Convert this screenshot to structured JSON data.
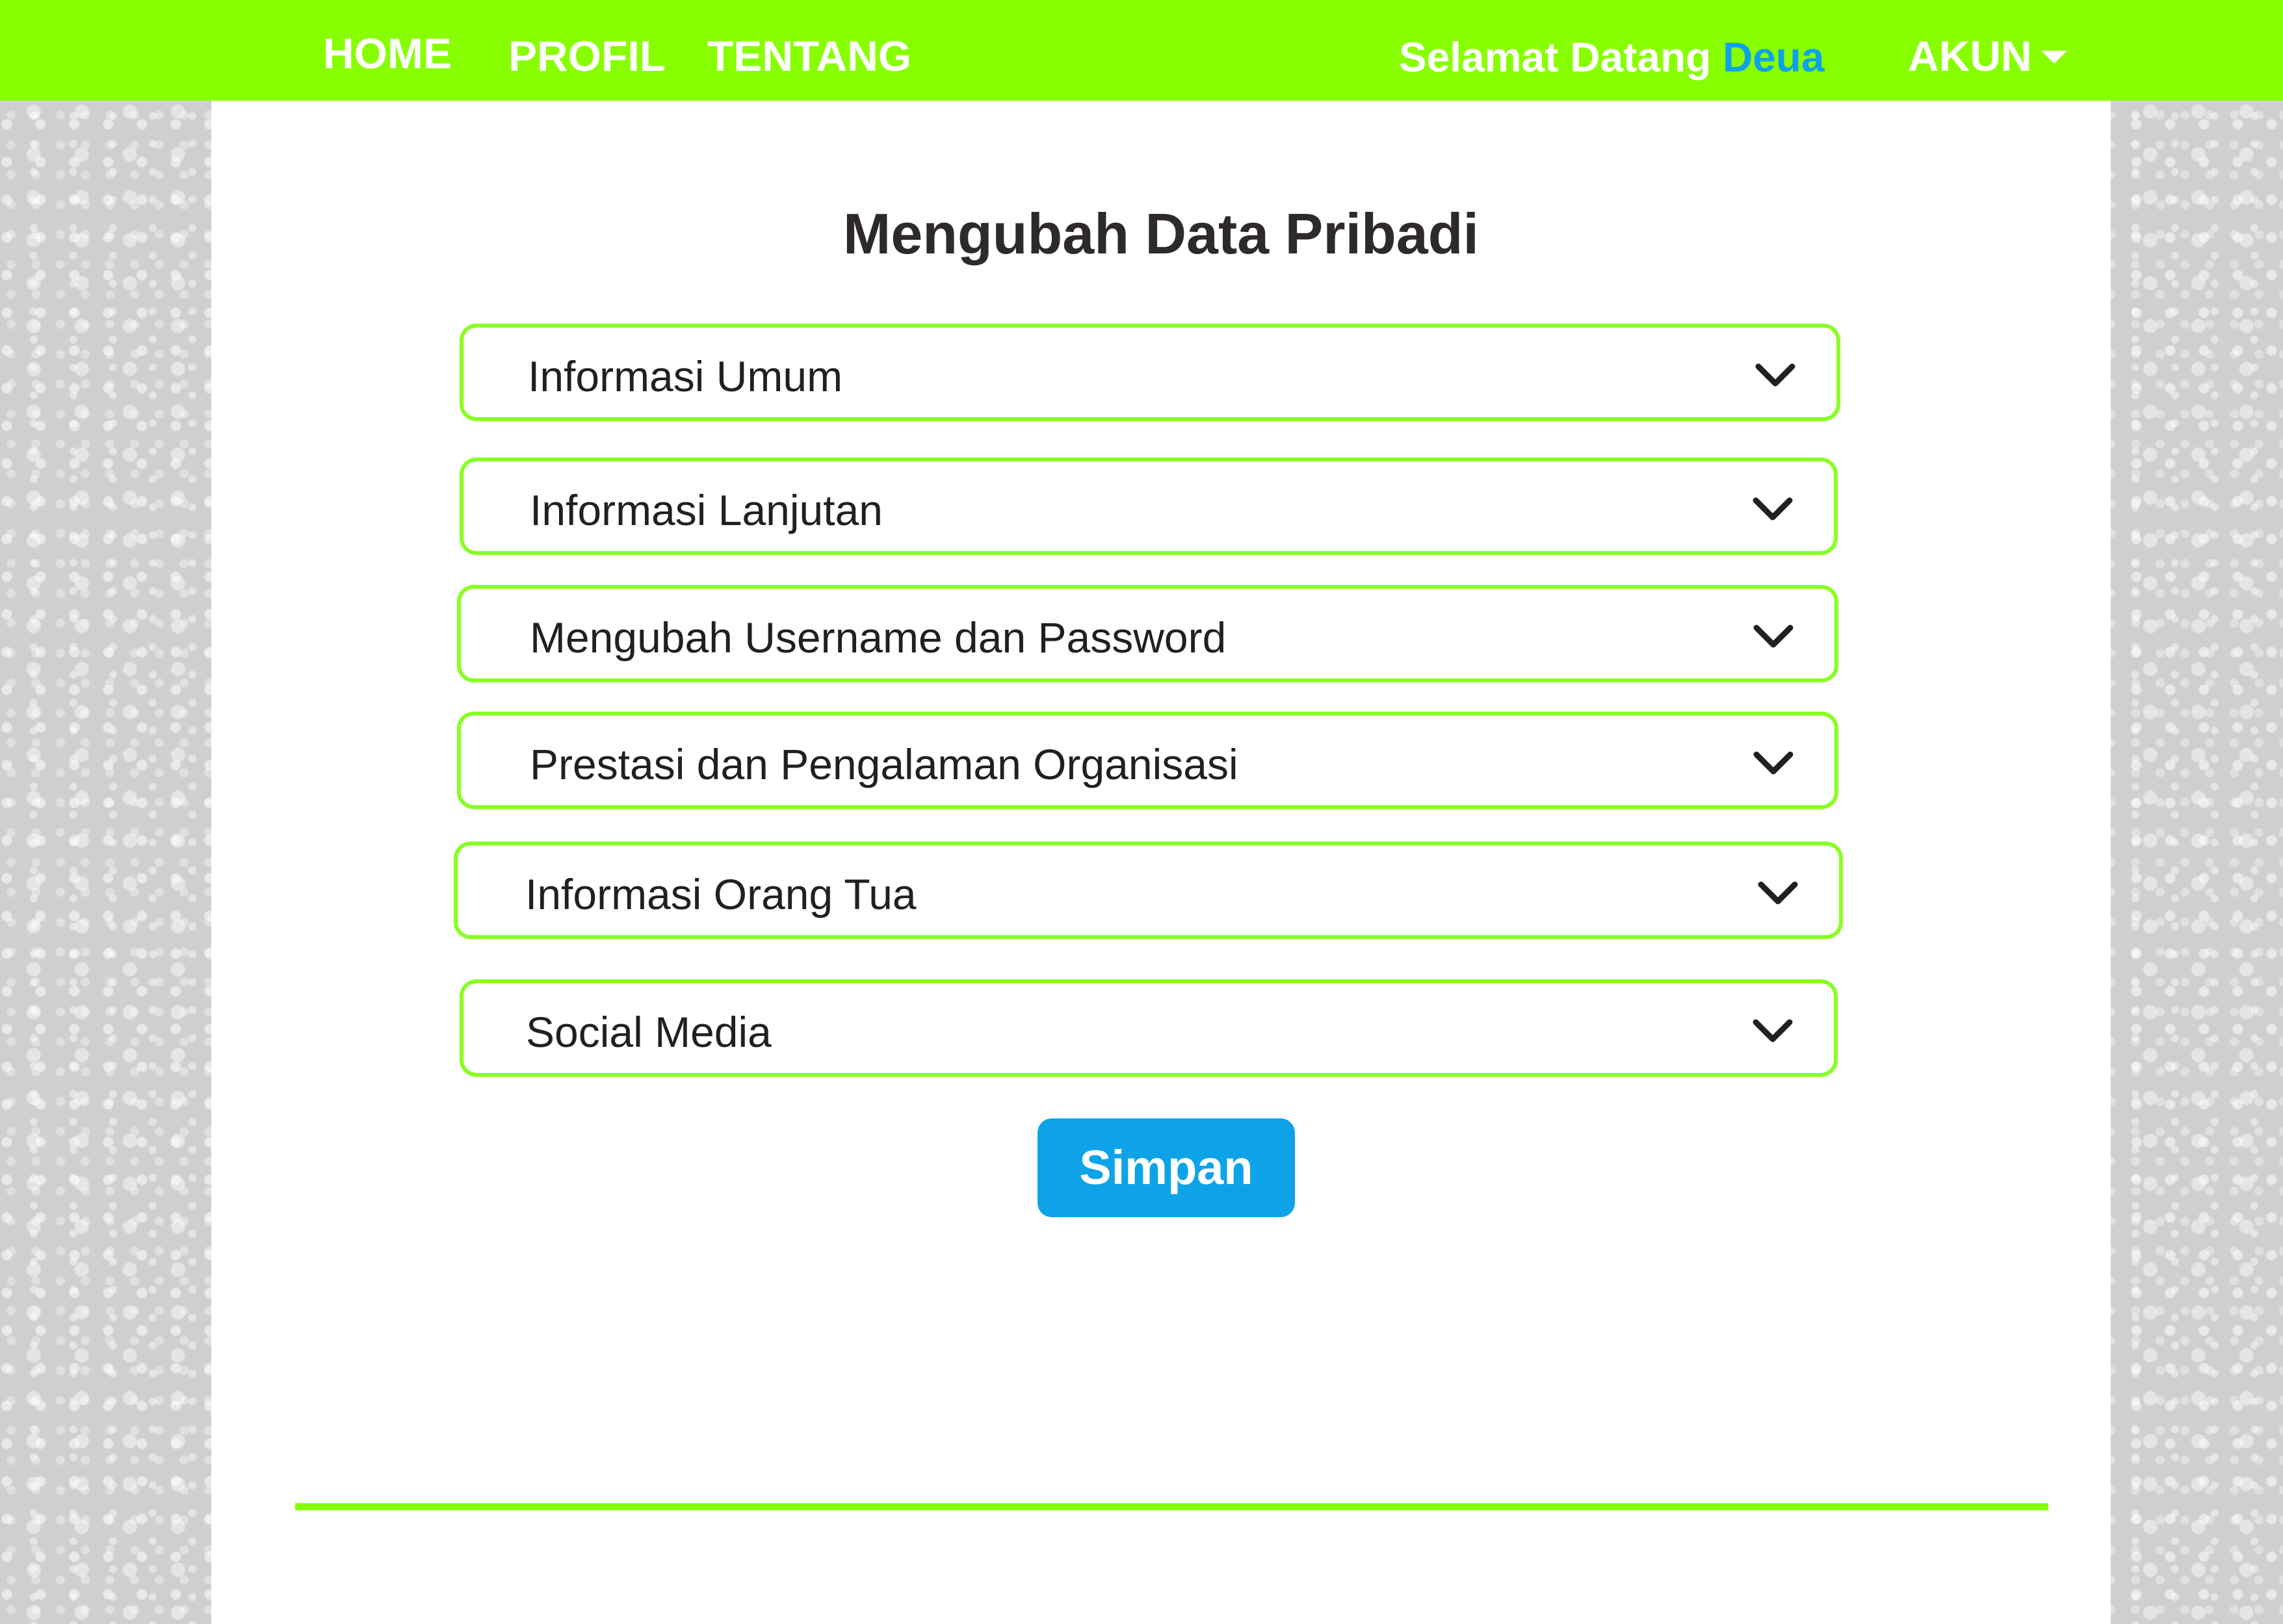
{
  "nav": {
    "home": "HOME",
    "profil": "PROFIL",
    "tentang": "TENTANG"
  },
  "header": {
    "welcome_text": "Selamat Datang",
    "username": "Deua",
    "account_label": "AKUN",
    "account_icon": "caret-down-icon"
  },
  "main": {
    "title": "Mengubah Data Pribadi",
    "sections": [
      {
        "label": "Informasi Umum",
        "icon": "chevron-down-icon"
      },
      {
        "label": "Informasi Lanjutan",
        "icon": "chevron-down-icon"
      },
      {
        "label": "Mengubah Username dan Password",
        "icon": "chevron-down-icon"
      },
      {
        "label": "Prestasi dan Pengalaman Organisasi",
        "icon": "chevron-down-icon"
      },
      {
        "label": "Informasi Orang Tua",
        "icon": "chevron-down-icon"
      },
      {
        "label": "Social Media",
        "icon": "chevron-down-icon"
      }
    ],
    "save_label": "Simpan"
  },
  "colors": {
    "brand_green": "#88ff00",
    "accent_blue": "#0ea3e8",
    "text_dark": "#231f20",
    "side_pattern": "#cfcfcf"
  }
}
